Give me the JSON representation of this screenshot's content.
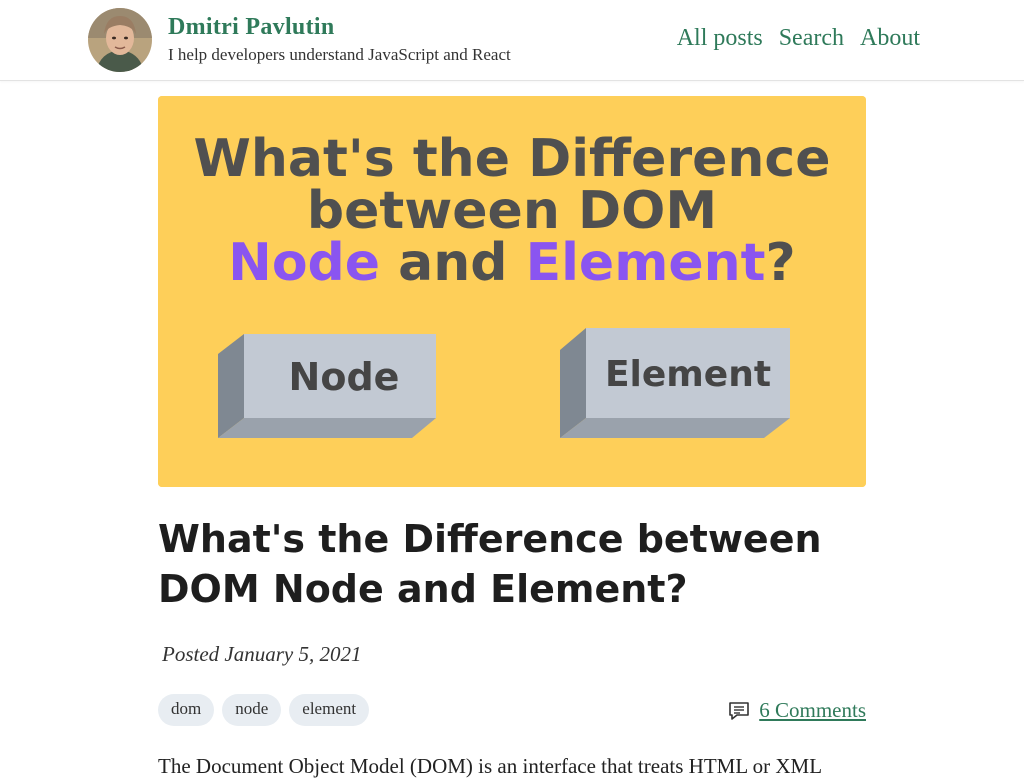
{
  "header": {
    "site_name": "Dmitri Pavlutin",
    "tagline": "I help developers understand JavaScript and React",
    "nav": [
      "All posts",
      "Search",
      "About"
    ]
  },
  "cover": {
    "line1": "What's the Difference",
    "line2": "between DOM",
    "line3_part1": "Node",
    "line3_part2": " and ",
    "line3_part3": "Element",
    "line3_part4": "?",
    "box_left": "Node",
    "box_right": "Element",
    "colors": {
      "background": "#fecf59",
      "text": "#505050",
      "accent": "#8a55f0",
      "box": "#c2c9d3"
    }
  },
  "post": {
    "title": "What's the Difference between DOM Node and Element?",
    "date": "Posted January 5, 2021",
    "tags": [
      "dom",
      "node",
      "element"
    ],
    "comments": "6 Comments",
    "intro": "The Document Object Model (DOM) is an interface that treats HTML or XML"
  },
  "theme": {
    "link_color": "#2f7a5a"
  }
}
